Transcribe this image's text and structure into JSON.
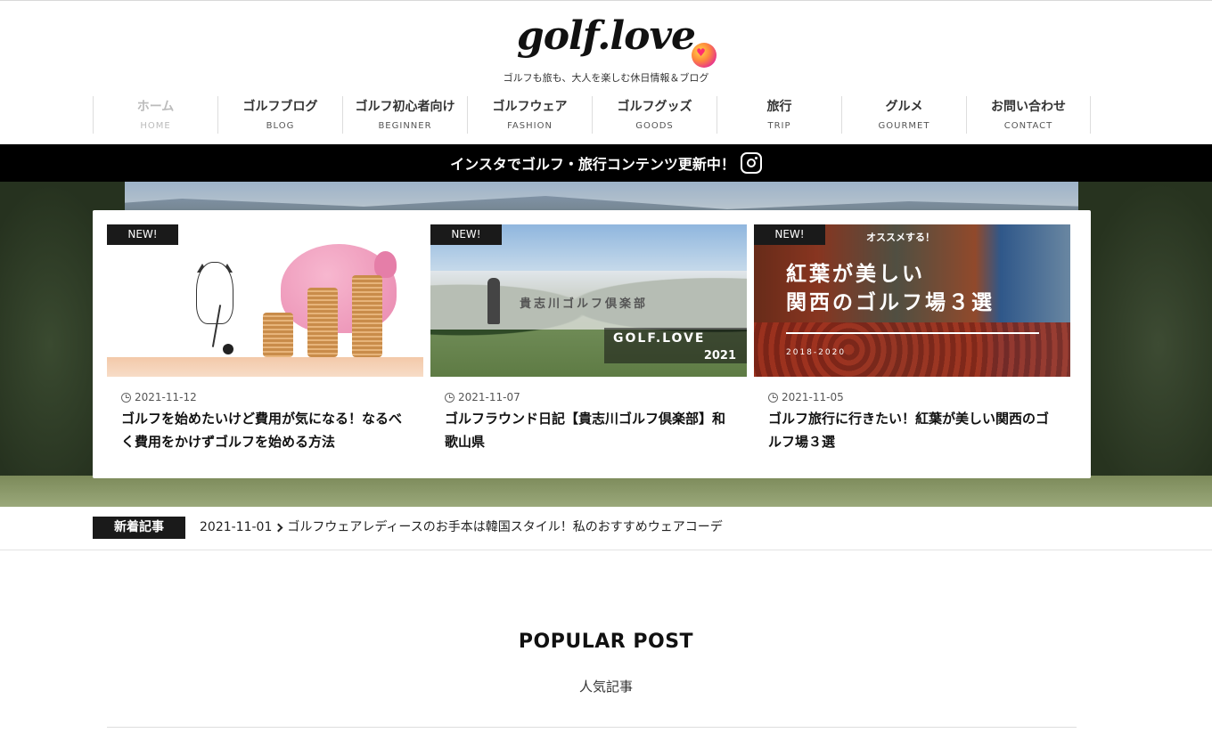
{
  "site": {
    "logo_text": "golf.love",
    "tagline": "ゴルフも旅も、大人を楽しむ休日情報＆ブログ"
  },
  "nav": [
    {
      "label": "ホーム",
      "sub": "HOME",
      "active": true
    },
    {
      "label": "ゴルフブログ",
      "sub": "BLOG"
    },
    {
      "label": "ゴルフ初心者向け",
      "sub": "BEGINNER"
    },
    {
      "label": "ゴルフウェア",
      "sub": "FASHION"
    },
    {
      "label": "ゴルフグッズ",
      "sub": "GOODS"
    },
    {
      "label": "旅行",
      "sub": "TRIP"
    },
    {
      "label": "グルメ",
      "sub": "GOURMET"
    },
    {
      "label": "お問い合わせ",
      "sub": "CONTACT"
    }
  ],
  "insta_banner": {
    "text": "インスタでゴルフ・旅行コンテンツ更新中！",
    "icon": "instagram-icon"
  },
  "featured": [
    {
      "badge": "NEW!",
      "date": "2021-11-12",
      "title": "ゴルフを始めたいけど費用が気になる！なるべく費用をかけずゴルフを始める方法"
    },
    {
      "badge": "NEW!",
      "date": "2021-11-07",
      "title": "ゴルフラウンド日記【貴志川ゴルフ倶楽部】和歌山県",
      "thumb_text": "貴志川ゴルフ倶楽部",
      "thumb_watermark": "GOLF.LOVE",
      "thumb_year": "2021"
    },
    {
      "badge": "NEW!",
      "date": "2021-11-05",
      "title": "ゴルフ旅行に行きたい！紅葉が美しい関西のゴルフ場３選",
      "thumb_sub": "オススメする！",
      "thumb_headline_1": "紅葉が美しい",
      "thumb_headline_2": "関西のゴルフ場３選",
      "thumb_years": "2018-2020"
    }
  ],
  "ticker": {
    "label": "新着記事",
    "date": "2021-11-01",
    "title": "ゴルフウェアレディースのお手本は韓国スタイル！私のおすすめウェアコーデ"
  },
  "popular": {
    "title": "POPULAR POST",
    "subtitle": "人気記事"
  }
}
